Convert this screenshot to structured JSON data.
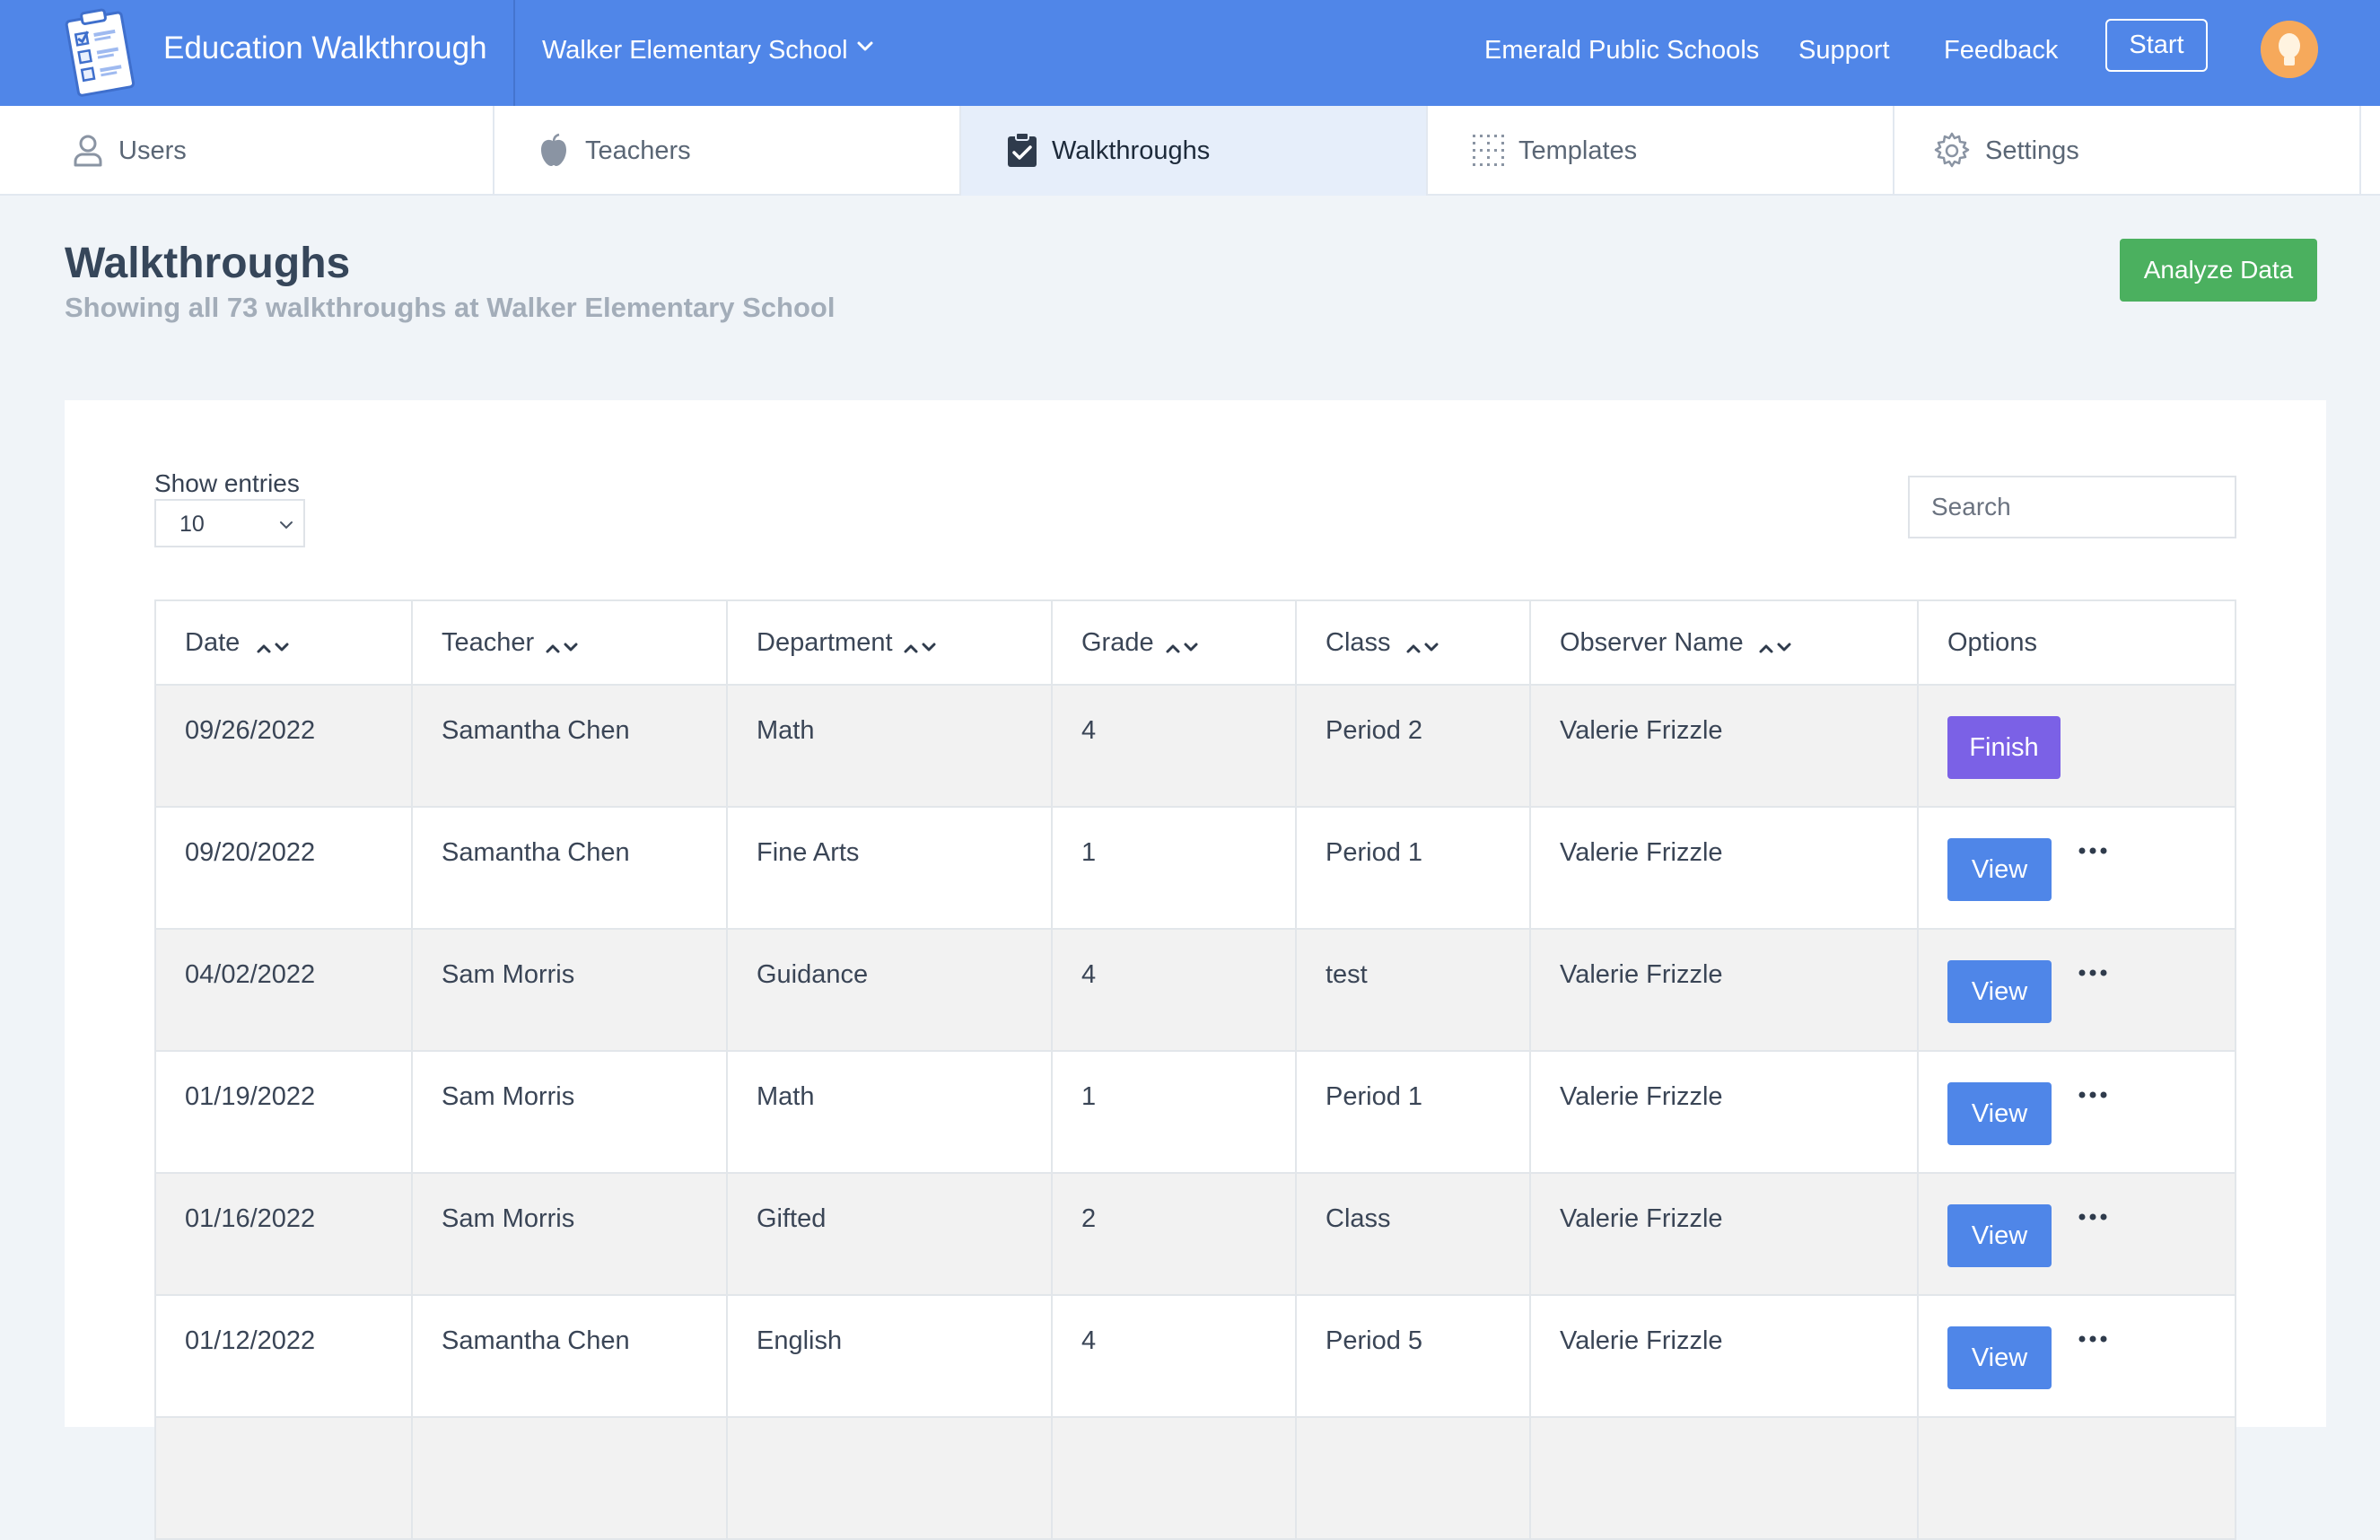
{
  "header": {
    "app_title": "Education Walkthrough",
    "school": "Walker Elementary School",
    "links": [
      "Emerald Public Schools",
      "Support",
      "Feedback"
    ],
    "start_label": "Start"
  },
  "tabs": [
    {
      "label": "Users",
      "icon": "user-icon",
      "active": false
    },
    {
      "label": "Teachers",
      "icon": "apple-icon",
      "active": false
    },
    {
      "label": "Walkthroughs",
      "icon": "clipboard-check-icon",
      "active": true
    },
    {
      "label": "Templates",
      "icon": "grid-icon",
      "active": false
    },
    {
      "label": "Settings",
      "icon": "gear-icon",
      "active": false
    }
  ],
  "page": {
    "title": "Walkthroughs",
    "subtitle": "Showing all 73 walkthroughs at Walker Elementary School",
    "analyze_label": "Analyze Data"
  },
  "controls": {
    "show_entries_label": "Show entries",
    "entries_value": "10",
    "search_placeholder": "Search"
  },
  "table": {
    "columns": [
      "Date",
      "Teacher",
      "Department",
      "Grade",
      "Class",
      "Observer Name",
      "Options"
    ],
    "rows": [
      {
        "date": "09/26/2022",
        "teacher": "Samantha Chen",
        "department": "Math",
        "grade": "4",
        "class": "Period 2",
        "observer": "Valerie Frizzle",
        "action": "Finish"
      },
      {
        "date": "09/20/2022",
        "teacher": "Samantha Chen",
        "department": "Fine Arts",
        "grade": "1",
        "class": "Period 1",
        "observer": "Valerie Frizzle",
        "action": "View"
      },
      {
        "date": "04/02/2022",
        "teacher": "Sam Morris",
        "department": "Guidance",
        "grade": "4",
        "class": "test",
        "observer": "Valerie Frizzle",
        "action": "View"
      },
      {
        "date": "01/19/2022",
        "teacher": "Sam Morris",
        "department": "Math",
        "grade": "1",
        "class": "Period 1",
        "observer": "Valerie Frizzle",
        "action": "View"
      },
      {
        "date": "01/16/2022",
        "teacher": "Sam Morris",
        "department": "Gifted",
        "grade": "2",
        "class": "Class",
        "observer": "Valerie Frizzle",
        "action": "View"
      },
      {
        "date": "01/12/2022",
        "teacher": "Samantha Chen",
        "department": "English",
        "grade": "4",
        "class": "Period 5",
        "observer": "Valerie Frizzle",
        "action": "View"
      }
    ]
  },
  "colors": {
    "header_bg": "#5086e8",
    "analyze_green": "#4bb05f",
    "finish_purple": "#7b61e6",
    "view_blue": "#4f86e8"
  }
}
